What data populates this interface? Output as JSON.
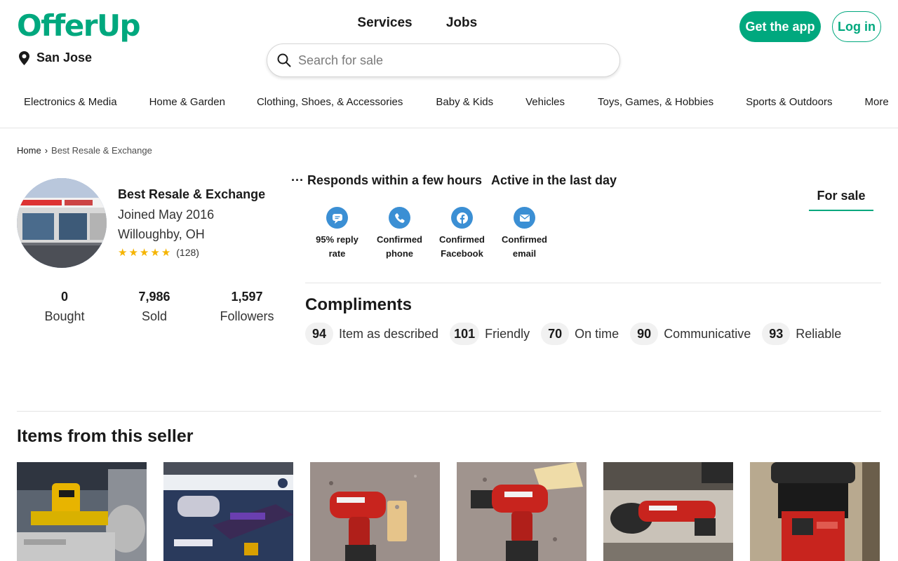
{
  "header": {
    "logo": "OfferUp",
    "location": "San Jose",
    "tabs": [
      {
        "label": "For sale",
        "active": true
      },
      {
        "label": "Services",
        "active": false
      },
      {
        "label": "Jobs",
        "active": false
      }
    ],
    "search_placeholder": "Search for sale",
    "get_app": "Get the app",
    "login": "Log in",
    "brand_color": "#00a87e"
  },
  "categories": [
    "Electronics & Media",
    "Home & Garden",
    "Clothing, Shoes, & Accessories",
    "Baby & Kids",
    "Vehicles",
    "Toys, Games, & Hobbies",
    "Sports & Outdoors",
    "More"
  ],
  "breadcrumb": {
    "home": "Home",
    "separator": "›",
    "current": "Best Resale & Exchange"
  },
  "seller": {
    "name": "Best Resale & Exchange",
    "joined": "Joined May 2016",
    "location": "Willoughby, OH",
    "rating_stars": 5,
    "rating_count": "(128)",
    "stats": [
      {
        "value": "0",
        "label": "Bought"
      },
      {
        "value": "7,986",
        "label": "Sold"
      },
      {
        "value": "1,597",
        "label": "Followers"
      }
    ],
    "responds": "Responds within a few hours",
    "active": "Active in the last day",
    "badges": [
      {
        "icon": "chat-bubble-icon",
        "line1": "95% reply",
        "line2": "rate"
      },
      {
        "icon": "phone-icon",
        "line1": "Confirmed",
        "line2": "phone"
      },
      {
        "icon": "facebook-icon",
        "line1": "Confirmed",
        "line2": "Facebook"
      },
      {
        "icon": "email-icon",
        "line1": "Confirmed",
        "line2": "email"
      }
    ]
  },
  "compliments": {
    "title": "Compliments",
    "items": [
      {
        "count": "94",
        "label": "Item as described"
      },
      {
        "count": "101",
        "label": "Friendly"
      },
      {
        "count": "70",
        "label": "On time"
      },
      {
        "count": "90",
        "label": "Communicative"
      },
      {
        "count": "93",
        "label": "Reliable"
      }
    ]
  },
  "items_section": {
    "title": "Items from this seller",
    "items": [
      {
        "image": "miter-saw"
      },
      {
        "image": "retro-game-console"
      },
      {
        "image": "impact-driver"
      },
      {
        "image": "power-drill"
      },
      {
        "image": "angle-grinder"
      },
      {
        "image": "wet-dry-vacuum"
      }
    ]
  }
}
